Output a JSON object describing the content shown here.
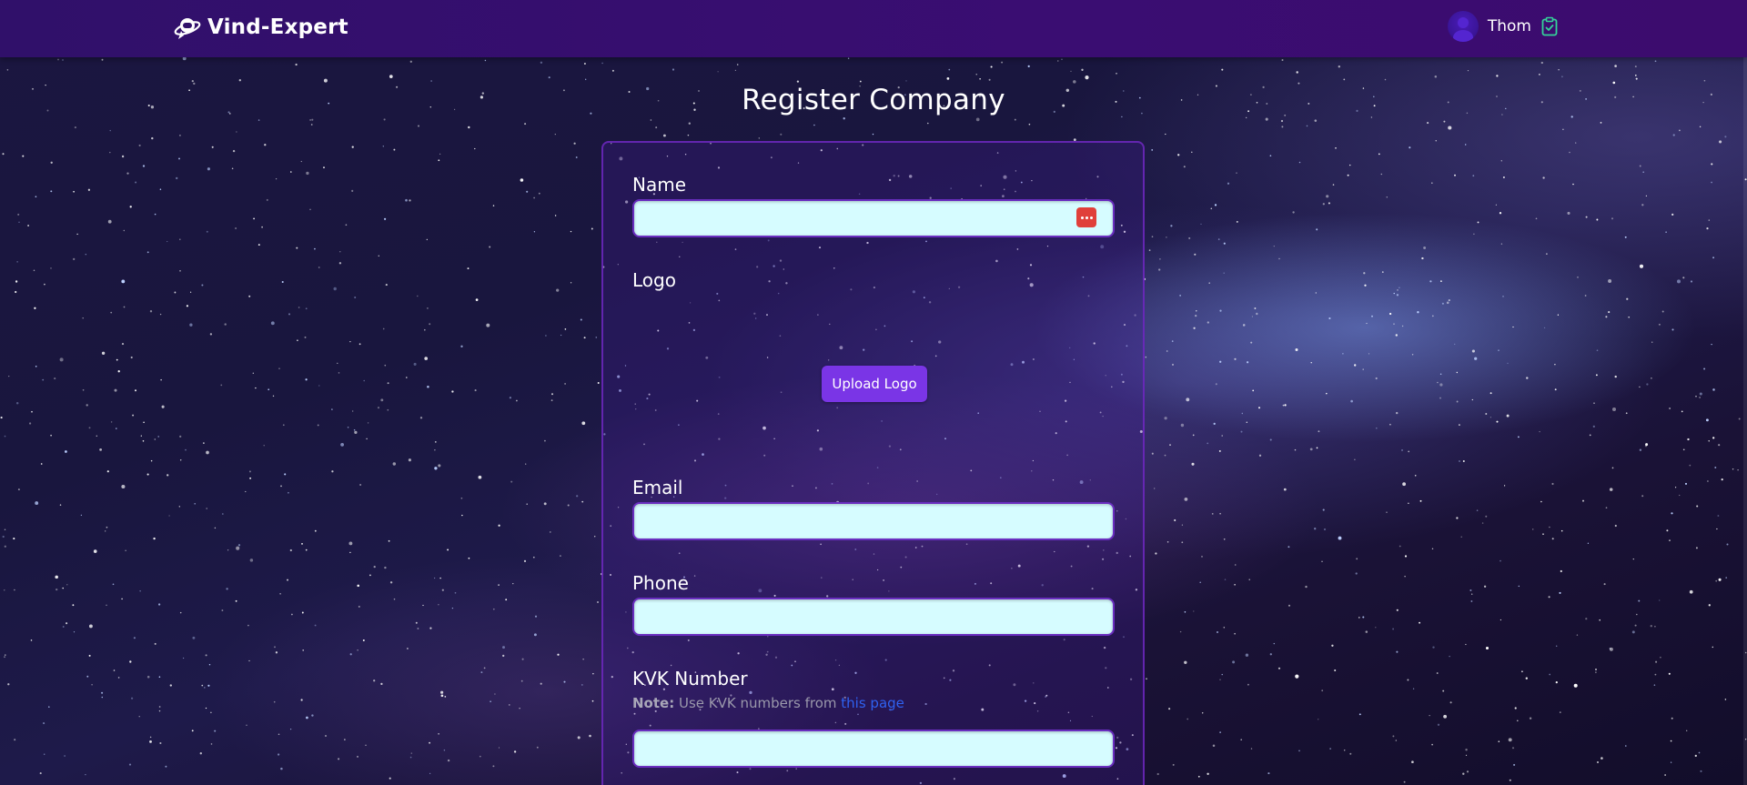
{
  "header": {
    "brand_name": "Vind-Expert",
    "brand_icon": "astronaut-logo-icon",
    "user_name": "Thom",
    "avatar_icon": "user-avatar-icon",
    "clipboard_icon": "clipboard-check-icon",
    "accent_color": "#3a0d72"
  },
  "page": {
    "title": "Register Company"
  },
  "form": {
    "name_label": "Name",
    "name_value": "",
    "password_manager_icon": "password-dots-icon",
    "logo_label": "Logo",
    "upload_logo_label": "Upload Logo",
    "email_label": "Email",
    "email_value": "",
    "phone_label": "Phone",
    "phone_value": "",
    "kvk_label": "KVK Number",
    "kvk_note_prefix": "Note:",
    "kvk_note_text": "Use KVK numbers from",
    "kvk_note_link": "this page",
    "kvk_value": "",
    "input_bg_color": "#d6fcff",
    "button_color": "#7a35e6"
  }
}
